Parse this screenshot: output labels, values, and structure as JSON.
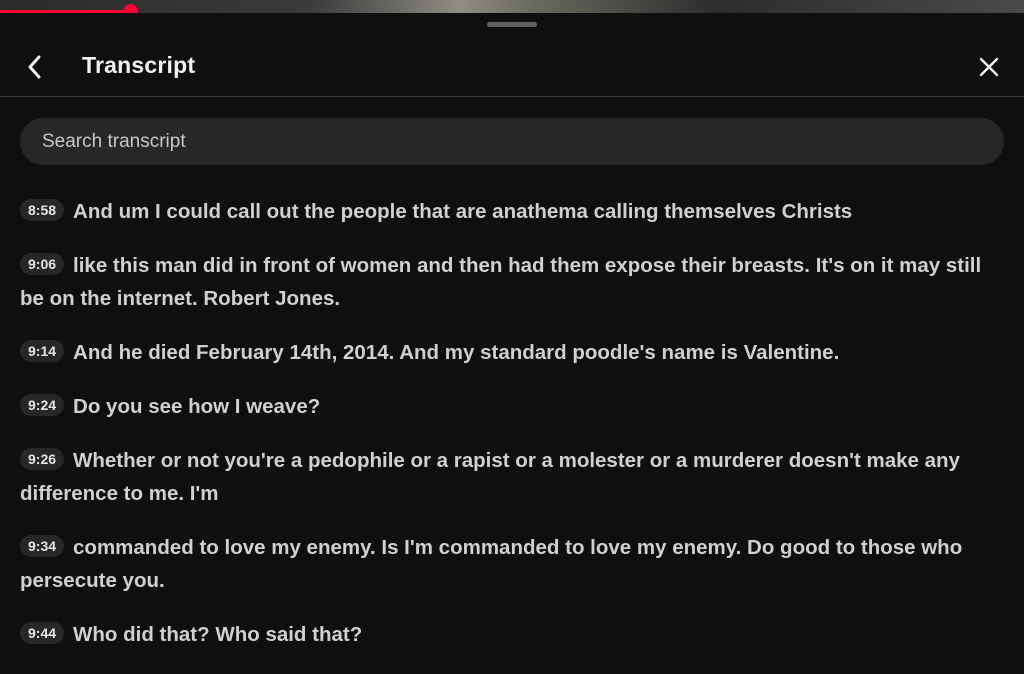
{
  "video": {
    "progress_fraction": 0.127
  },
  "header": {
    "title": "Transcript",
    "back_icon": "chevron-left-icon",
    "close_icon": "close-icon"
  },
  "search": {
    "placeholder": "Search transcript"
  },
  "segments": [
    {
      "timestamp": "8:58",
      "text": "And um I could call out the people that are anathema calling themselves Christs"
    },
    {
      "timestamp": "9:06",
      "text": "like this man did in front of women and then had them expose their breasts. It's on it may still be on the internet. Robert Jones."
    },
    {
      "timestamp": "9:14",
      "text": "And he died February 14th, 2014. And my standard poodle's name is Valentine."
    },
    {
      "timestamp": "9:24",
      "text": "Do you see how I weave?"
    },
    {
      "timestamp": "9:26",
      "text": "Whether or not you're a pedophile or a rapist or a molester or a murderer doesn't make any difference to me. I'm"
    },
    {
      "timestamp": "9:34",
      "text": "commanded to love my enemy. Is I'm commanded to love my enemy. Do good to those who persecute you."
    },
    {
      "timestamp": "9:44",
      "text": "Who did that? Who said that?"
    }
  ],
  "colors": {
    "background": "#0f0f0f",
    "accent": "#ff0033",
    "chip": "#272727"
  }
}
